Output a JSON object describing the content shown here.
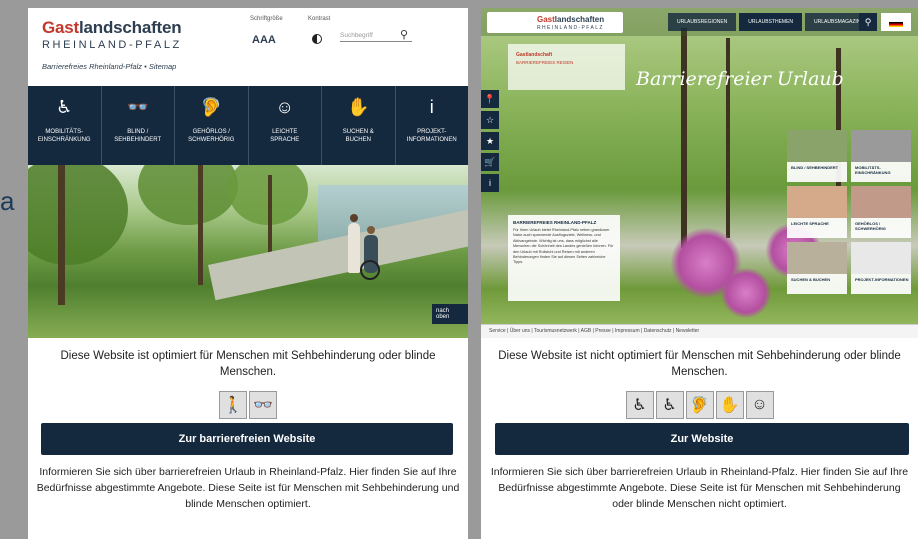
{
  "stray_char": "a",
  "left": {
    "brand": {
      "part_red": "Gast",
      "part_dark": "landschaften",
      "line2": "RHEINLAND-PFALZ"
    },
    "breadcrumb": "Barrierefreies Rheinland-Pfalz • Sitemap",
    "controls": {
      "font_label": "Schriftgröße",
      "font_value": "AAA",
      "contrast_label": "Kontrast"
    },
    "search_placeholder": "Suchbegriff",
    "nav": [
      {
        "icon": "mobility-icon",
        "glyph": "♿",
        "label1": "MOBILITÄTS-",
        "label2": "EINSCHRÄNKUNG"
      },
      {
        "icon": "blind-icon",
        "glyph": "👓",
        "label1": "BLIND /",
        "label2": "SEHBEHINDERT"
      },
      {
        "icon": "deaf-icon",
        "glyph": "🦻",
        "label1": "GEHÖRLOS /",
        "label2": "SCHWERHÖRIG"
      },
      {
        "icon": "easy-language-icon",
        "glyph": "☺",
        "label1": "LEICHTE",
        "label2": "SPRACHE"
      },
      {
        "icon": "search-book-icon",
        "glyph": "✋",
        "label1": "SUCHEN &",
        "label2": "BUCHEN"
      },
      {
        "icon": "info-icon",
        "glyph": "i",
        "label1": "PROJEKT-",
        "label2": "INFORMATIONEN"
      }
    ],
    "back_to_top": "nach oben",
    "description": "Diese Website ist optimiert für Menschen mit Sehbehinderung oder blinde Menschen.",
    "icons": [
      {
        "name": "walking-cane-icon",
        "glyph": "🚶"
      },
      {
        "name": "glasses-icon",
        "glyph": "👓"
      }
    ],
    "cta_label": "Zur barrierefreien Website",
    "info": "Informieren Sie sich über barrierefreien Urlaub in Rheinland-Pfalz. Hier finden Sie auf Ihre Bedürfnisse abgestimmte Angebote. Diese Seite ist für Menschen mit Sehbehinderung und blinde Menschen optimiert."
  },
  "right": {
    "brand": {
      "part_red": "Gast",
      "part_dark": "landschaften",
      "line2": "RHEINLAND-PFALZ"
    },
    "panel": {
      "line1": "Gastlandschaft",
      "line2": "BARRIEREFREIES REISEN"
    },
    "tabs": [
      "URLAUBSREGIONEN",
      "URLAUBSTHEMEN",
      "URLAUBSMAGAZIN"
    ],
    "script_title": "Barrierefreier Urlaub",
    "sidebar": [
      "📍",
      "☆",
      "★",
      "🛒",
      "i"
    ],
    "info_box": {
      "title": "BARRIEREFREIES RHEINLAND-PFALZ",
      "body": "Für Ihren Urlaub bietet Rheinland-Pfalz neben grandioser Natur auch spannende Ausflugsziele, Wellness- und Aktivangebote. Wichtig ist uns, dass möglichst alle Menschen die Schönheit des Landes genießen können. Für den Urlaub mit Rollstuhl und Reisen mit anderen Behinderungen finden Sie auf diesen Seiten zahlreiche Tipps."
    },
    "tiles": [
      {
        "label": "BLIND / SEHBEHINDERT",
        "color": "#8aa36a"
      },
      {
        "label": "MOBILITÄTS-EINSCHRÄNKUNG",
        "color": "#9a9a9a"
      },
      {
        "label": "LEICHTE SPRACHE",
        "color": "#d4aa8a"
      },
      {
        "label": "GEHÖRLOS / SCHWERHÖRIG",
        "color": "#c29a8a"
      },
      {
        "label": "SUCHEN & BUCHEN",
        "color": "#b8b09a"
      },
      {
        "label": "PROJEKT-INFORMATIONEN",
        "color": "#e8e8e8"
      }
    ],
    "footer": "Service | Über uns | Tourismusnetzwerk | AGB | Presse | Impressum | Datenschutz | Newsletter",
    "description": "Diese Website ist nicht optimiert für Menschen mit Sehbehinderung oder blinde Menschen.",
    "icons": [
      {
        "name": "mobility-icon",
        "glyph": "♿"
      },
      {
        "name": "wheelchair-icon",
        "glyph": "♿"
      },
      {
        "name": "ear-icon",
        "glyph": "🦻"
      },
      {
        "name": "sign-language-icon",
        "glyph": "✋"
      },
      {
        "name": "easy-reading-icon",
        "glyph": "☺"
      }
    ],
    "cta_label": "Zur Website",
    "info": "Informieren Sie sich über barrierefreien Urlaub in Rheinland-Pfalz. Hier finden Sie auf Ihre Bedürfnisse abgestimmte Angebote. Diese Seite ist für Menschen mit Sehbehinderung oder blinde Menschen nicht optimiert."
  }
}
